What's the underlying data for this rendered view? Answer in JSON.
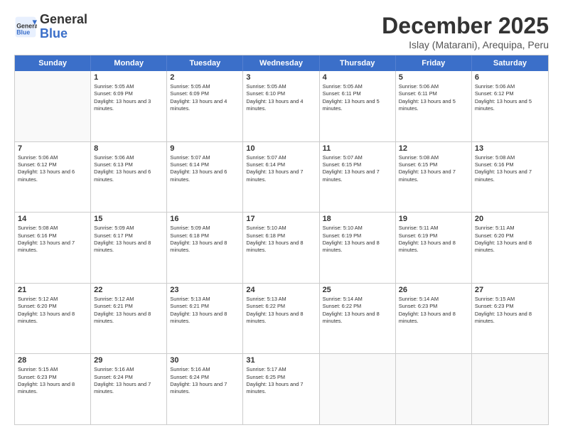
{
  "logo": {
    "line1": "General",
    "line2": "Blue"
  },
  "title": "December 2025",
  "location": "Islay (Matarani), Arequipa, Peru",
  "header": {
    "days": [
      "Sunday",
      "Monday",
      "Tuesday",
      "Wednesday",
      "Thursday",
      "Friday",
      "Saturday"
    ]
  },
  "weeks": [
    [
      {
        "day": "",
        "empty": true
      },
      {
        "day": "1",
        "sunrise": "5:05 AM",
        "sunset": "6:09 PM",
        "daylight": "13 hours and 3 minutes."
      },
      {
        "day": "2",
        "sunrise": "5:05 AM",
        "sunset": "6:09 PM",
        "daylight": "13 hours and 4 minutes."
      },
      {
        "day": "3",
        "sunrise": "5:05 AM",
        "sunset": "6:10 PM",
        "daylight": "13 hours and 4 minutes."
      },
      {
        "day": "4",
        "sunrise": "5:05 AM",
        "sunset": "6:11 PM",
        "daylight": "13 hours and 5 minutes."
      },
      {
        "day": "5",
        "sunrise": "5:06 AM",
        "sunset": "6:11 PM",
        "daylight": "13 hours and 5 minutes."
      },
      {
        "day": "6",
        "sunrise": "5:06 AM",
        "sunset": "6:12 PM",
        "daylight": "13 hours and 5 minutes."
      }
    ],
    [
      {
        "day": "7",
        "sunrise": "5:06 AM",
        "sunset": "6:12 PM",
        "daylight": "13 hours and 6 minutes."
      },
      {
        "day": "8",
        "sunrise": "5:06 AM",
        "sunset": "6:13 PM",
        "daylight": "13 hours and 6 minutes."
      },
      {
        "day": "9",
        "sunrise": "5:07 AM",
        "sunset": "6:14 PM",
        "daylight": "13 hours and 6 minutes."
      },
      {
        "day": "10",
        "sunrise": "5:07 AM",
        "sunset": "6:14 PM",
        "daylight": "13 hours and 7 minutes."
      },
      {
        "day": "11",
        "sunrise": "5:07 AM",
        "sunset": "6:15 PM",
        "daylight": "13 hours and 7 minutes."
      },
      {
        "day": "12",
        "sunrise": "5:08 AM",
        "sunset": "6:15 PM",
        "daylight": "13 hours and 7 minutes."
      },
      {
        "day": "13",
        "sunrise": "5:08 AM",
        "sunset": "6:16 PM",
        "daylight": "13 hours and 7 minutes."
      }
    ],
    [
      {
        "day": "14",
        "sunrise": "5:08 AM",
        "sunset": "6:16 PM",
        "daylight": "13 hours and 7 minutes."
      },
      {
        "day": "15",
        "sunrise": "5:09 AM",
        "sunset": "6:17 PM",
        "daylight": "13 hours and 8 minutes."
      },
      {
        "day": "16",
        "sunrise": "5:09 AM",
        "sunset": "6:18 PM",
        "daylight": "13 hours and 8 minutes."
      },
      {
        "day": "17",
        "sunrise": "5:10 AM",
        "sunset": "6:18 PM",
        "daylight": "13 hours and 8 minutes."
      },
      {
        "day": "18",
        "sunrise": "5:10 AM",
        "sunset": "6:19 PM",
        "daylight": "13 hours and 8 minutes."
      },
      {
        "day": "19",
        "sunrise": "5:11 AM",
        "sunset": "6:19 PM",
        "daylight": "13 hours and 8 minutes."
      },
      {
        "day": "20",
        "sunrise": "5:11 AM",
        "sunset": "6:20 PM",
        "daylight": "13 hours and 8 minutes."
      }
    ],
    [
      {
        "day": "21",
        "sunrise": "5:12 AM",
        "sunset": "6:20 PM",
        "daylight": "13 hours and 8 minutes."
      },
      {
        "day": "22",
        "sunrise": "5:12 AM",
        "sunset": "6:21 PM",
        "daylight": "13 hours and 8 minutes."
      },
      {
        "day": "23",
        "sunrise": "5:13 AM",
        "sunset": "6:21 PM",
        "daylight": "13 hours and 8 minutes."
      },
      {
        "day": "24",
        "sunrise": "5:13 AM",
        "sunset": "6:22 PM",
        "daylight": "13 hours and 8 minutes."
      },
      {
        "day": "25",
        "sunrise": "5:14 AM",
        "sunset": "6:22 PM",
        "daylight": "13 hours and 8 minutes."
      },
      {
        "day": "26",
        "sunrise": "5:14 AM",
        "sunset": "6:23 PM",
        "daylight": "13 hours and 8 minutes."
      },
      {
        "day": "27",
        "sunrise": "5:15 AM",
        "sunset": "6:23 PM",
        "daylight": "13 hours and 8 minutes."
      }
    ],
    [
      {
        "day": "28",
        "sunrise": "5:15 AM",
        "sunset": "6:23 PM",
        "daylight": "13 hours and 8 minutes."
      },
      {
        "day": "29",
        "sunrise": "5:16 AM",
        "sunset": "6:24 PM",
        "daylight": "13 hours and 7 minutes."
      },
      {
        "day": "30",
        "sunrise": "5:16 AM",
        "sunset": "6:24 PM",
        "daylight": "13 hours and 7 minutes."
      },
      {
        "day": "31",
        "sunrise": "5:17 AM",
        "sunset": "6:25 PM",
        "daylight": "13 hours and 7 minutes."
      },
      {
        "day": "",
        "empty": true
      },
      {
        "day": "",
        "empty": true
      },
      {
        "day": "",
        "empty": true
      }
    ]
  ]
}
